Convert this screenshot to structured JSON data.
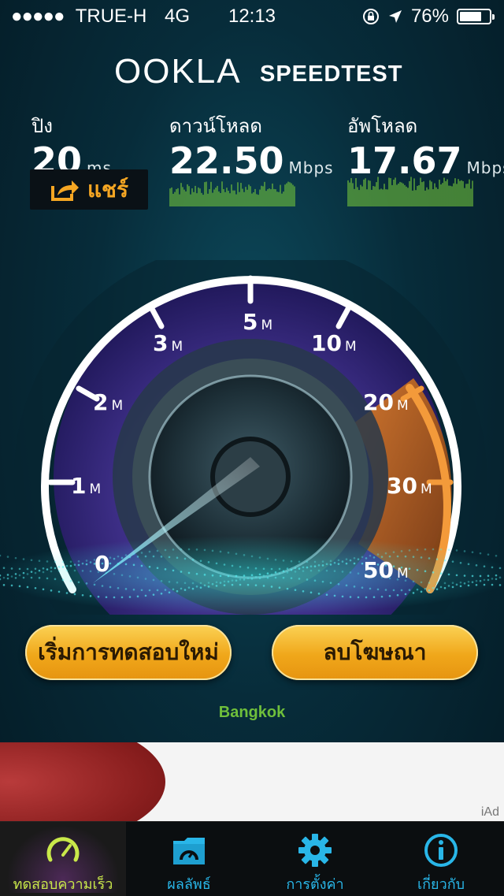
{
  "status_bar": {
    "signal": "●●●●●",
    "carrier": "TRUE-H",
    "network": "4G",
    "time": "12:13",
    "battery": "76%",
    "battery_level": 0.76
  },
  "header": {
    "logo_left": "OOKLA",
    "logo_right": "SPEEDTEST"
  },
  "stats": {
    "ping": {
      "label": "ปิง",
      "value": "20",
      "unit": "ms"
    },
    "download": {
      "label": "ดาวน์โหลด",
      "value": "22.50",
      "unit": "Mbps"
    },
    "upload": {
      "label": "อัพโหลด",
      "value": "17.67",
      "unit": "Mbps"
    }
  },
  "share": {
    "label": "แชร์"
  },
  "gauge": {
    "ticks": [
      {
        "n": "0",
        "u": ""
      },
      {
        "n": "1",
        "u": "M"
      },
      {
        "n": "2",
        "u": "M"
      },
      {
        "n": "3",
        "u": "M"
      },
      {
        "n": "5",
        "u": "M"
      },
      {
        "n": "10",
        "u": "M"
      },
      {
        "n": "20",
        "u": "M"
      },
      {
        "n": "30",
        "u": "M"
      },
      {
        "n": "50",
        "u": "M"
      }
    ]
  },
  "buttons": {
    "restart": "เริ่มการทดสอบใหม่",
    "remove_ads": "ลบโฆษณา"
  },
  "location": "Bangkok",
  "ad": {
    "label": "iAd"
  },
  "tabs": [
    {
      "label": "ทดสอบความเร็ว",
      "icon": "speedometer-icon",
      "active": true
    },
    {
      "label": "ผลลัพธ์",
      "icon": "results-folder-icon",
      "active": false
    },
    {
      "label": "การตั้งค่า",
      "icon": "gear-icon",
      "active": false
    },
    {
      "label": "เกี่ยวกับ",
      "icon": "info-icon",
      "active": false
    }
  ],
  "colors": {
    "accent_orange": "#f5a623",
    "tab_blue": "#29b6e8",
    "tab_active": "#c9e84a",
    "sparkline_green": "#6fbf3b"
  }
}
